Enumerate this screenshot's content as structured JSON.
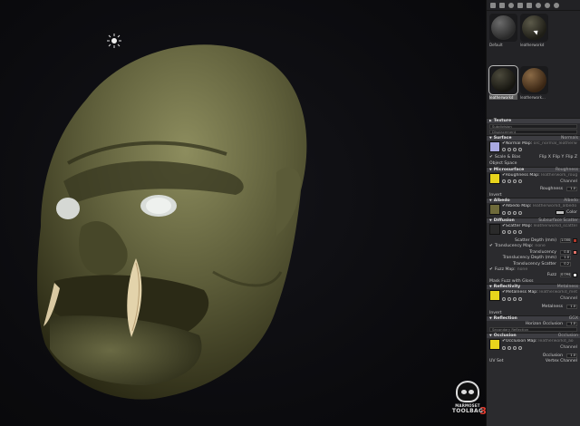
{
  "viewport": {
    "light_icon": "light-bulb-icon"
  },
  "logo": {
    "line1": "MARMOSET",
    "line2": "TOOLBAG",
    "version": "3"
  },
  "toolbar": {
    "icons": [
      "new-icon",
      "duplicate-icon",
      "settings-icon",
      "delete-icon",
      "grid-icon",
      "palette-icon",
      "gear-icon",
      "compass-icon"
    ]
  },
  "materials": [
    {
      "label": "Default"
    },
    {
      "label": "leatherworkd"
    },
    {
      "label": "leatherworkd"
    },
    {
      "label": "leatherwork..."
    }
  ],
  "texture": {
    "title": "Texture",
    "dd1": "Subdivision",
    "dd2": "Displacement"
  },
  "surface": {
    "title": "Surface",
    "right": "Normals",
    "map_label": "Normal Map:",
    "map_file": "orc_normal_leatherworked",
    "scale_bias": "Scale & Bias",
    "flip_x": "Flip X",
    "flip_y": "Flip Y",
    "flip_z": "Flip Z",
    "object_space": "Object Space"
  },
  "microsurface": {
    "title": "Microsurface",
    "right": "Roughness",
    "map_label": "Roughness Map:",
    "map_file": "leatherwork_roughness",
    "channel": "Channel",
    "roughness_label": "Roughness",
    "roughness_val": "1.0",
    "invert": "Invert"
  },
  "albedo": {
    "title": "Albedo",
    "right": "Albedo",
    "map_label": "Albedo Map:",
    "map_file": "leatherworkd_albedo",
    "color_label": "Color"
  },
  "diffusion": {
    "title": "Diffusion",
    "right": "Subsurface Scatter",
    "map_label": "Scatter Map:",
    "map_file": "leatherworkd_scatter",
    "scatter_depth_label": "Scatter Depth (mm)",
    "scatter_depth_val": "1.000",
    "trans_map_label": "Translucency Map:",
    "trans_map_file": "none",
    "translucency_label": "Translucency",
    "translucency_val": "0.8",
    "trans_depth_label": "Translucency Depth (mm)",
    "trans_depth_val": "1.0",
    "trans_scatter_label": "Translucency Scatter",
    "trans_scatter_val": "0.2",
    "fuzz_map_label": "Fuzz Map:",
    "fuzz_map_file": "none",
    "fuzz_label": "Fuzz",
    "fuzz_val": "0.094",
    "mask_fuzz": "Mask Fuzz with Gloss"
  },
  "reflectivity": {
    "title": "Reflectivity",
    "right": "Metalness",
    "map_label": "Metalness Map:",
    "map_file": "leatherworkd_metalness",
    "channel": "Channel",
    "metalness_label": "Metalness",
    "metalness_val": "1.0",
    "invert": "Invert"
  },
  "reflection": {
    "title": "Reflection",
    "right": "GGX",
    "horizon_label": "Horizon Occlusion",
    "horizon_val": "1.0",
    "secondary": "Secondary Reflection"
  },
  "occlusion": {
    "title": "Occlusion",
    "right": "Occlusion",
    "map_label": "Occlusion Map:",
    "map_file": "leatherworkd_ao",
    "channel": "Channel",
    "occlusion_label": "Occlusion",
    "occlusion_val": "1.0",
    "uv_set": "UV Set",
    "vertex_channel": "Vertex Channel"
  },
  "colors": {
    "normal_swatch": "#a9a8e0",
    "roughness_swatch": "#e8d41c",
    "albedo_swatch": "#6e6a3a",
    "scatter_chip": "#b33a2c",
    "translucency_chip": "#e0726a",
    "fuzz_chip": "#f4f4f4",
    "metal_swatch": "#e8d41c",
    "occlusion_swatch": "#e8d41c",
    "albedo_color": "#bfbfbf"
  }
}
